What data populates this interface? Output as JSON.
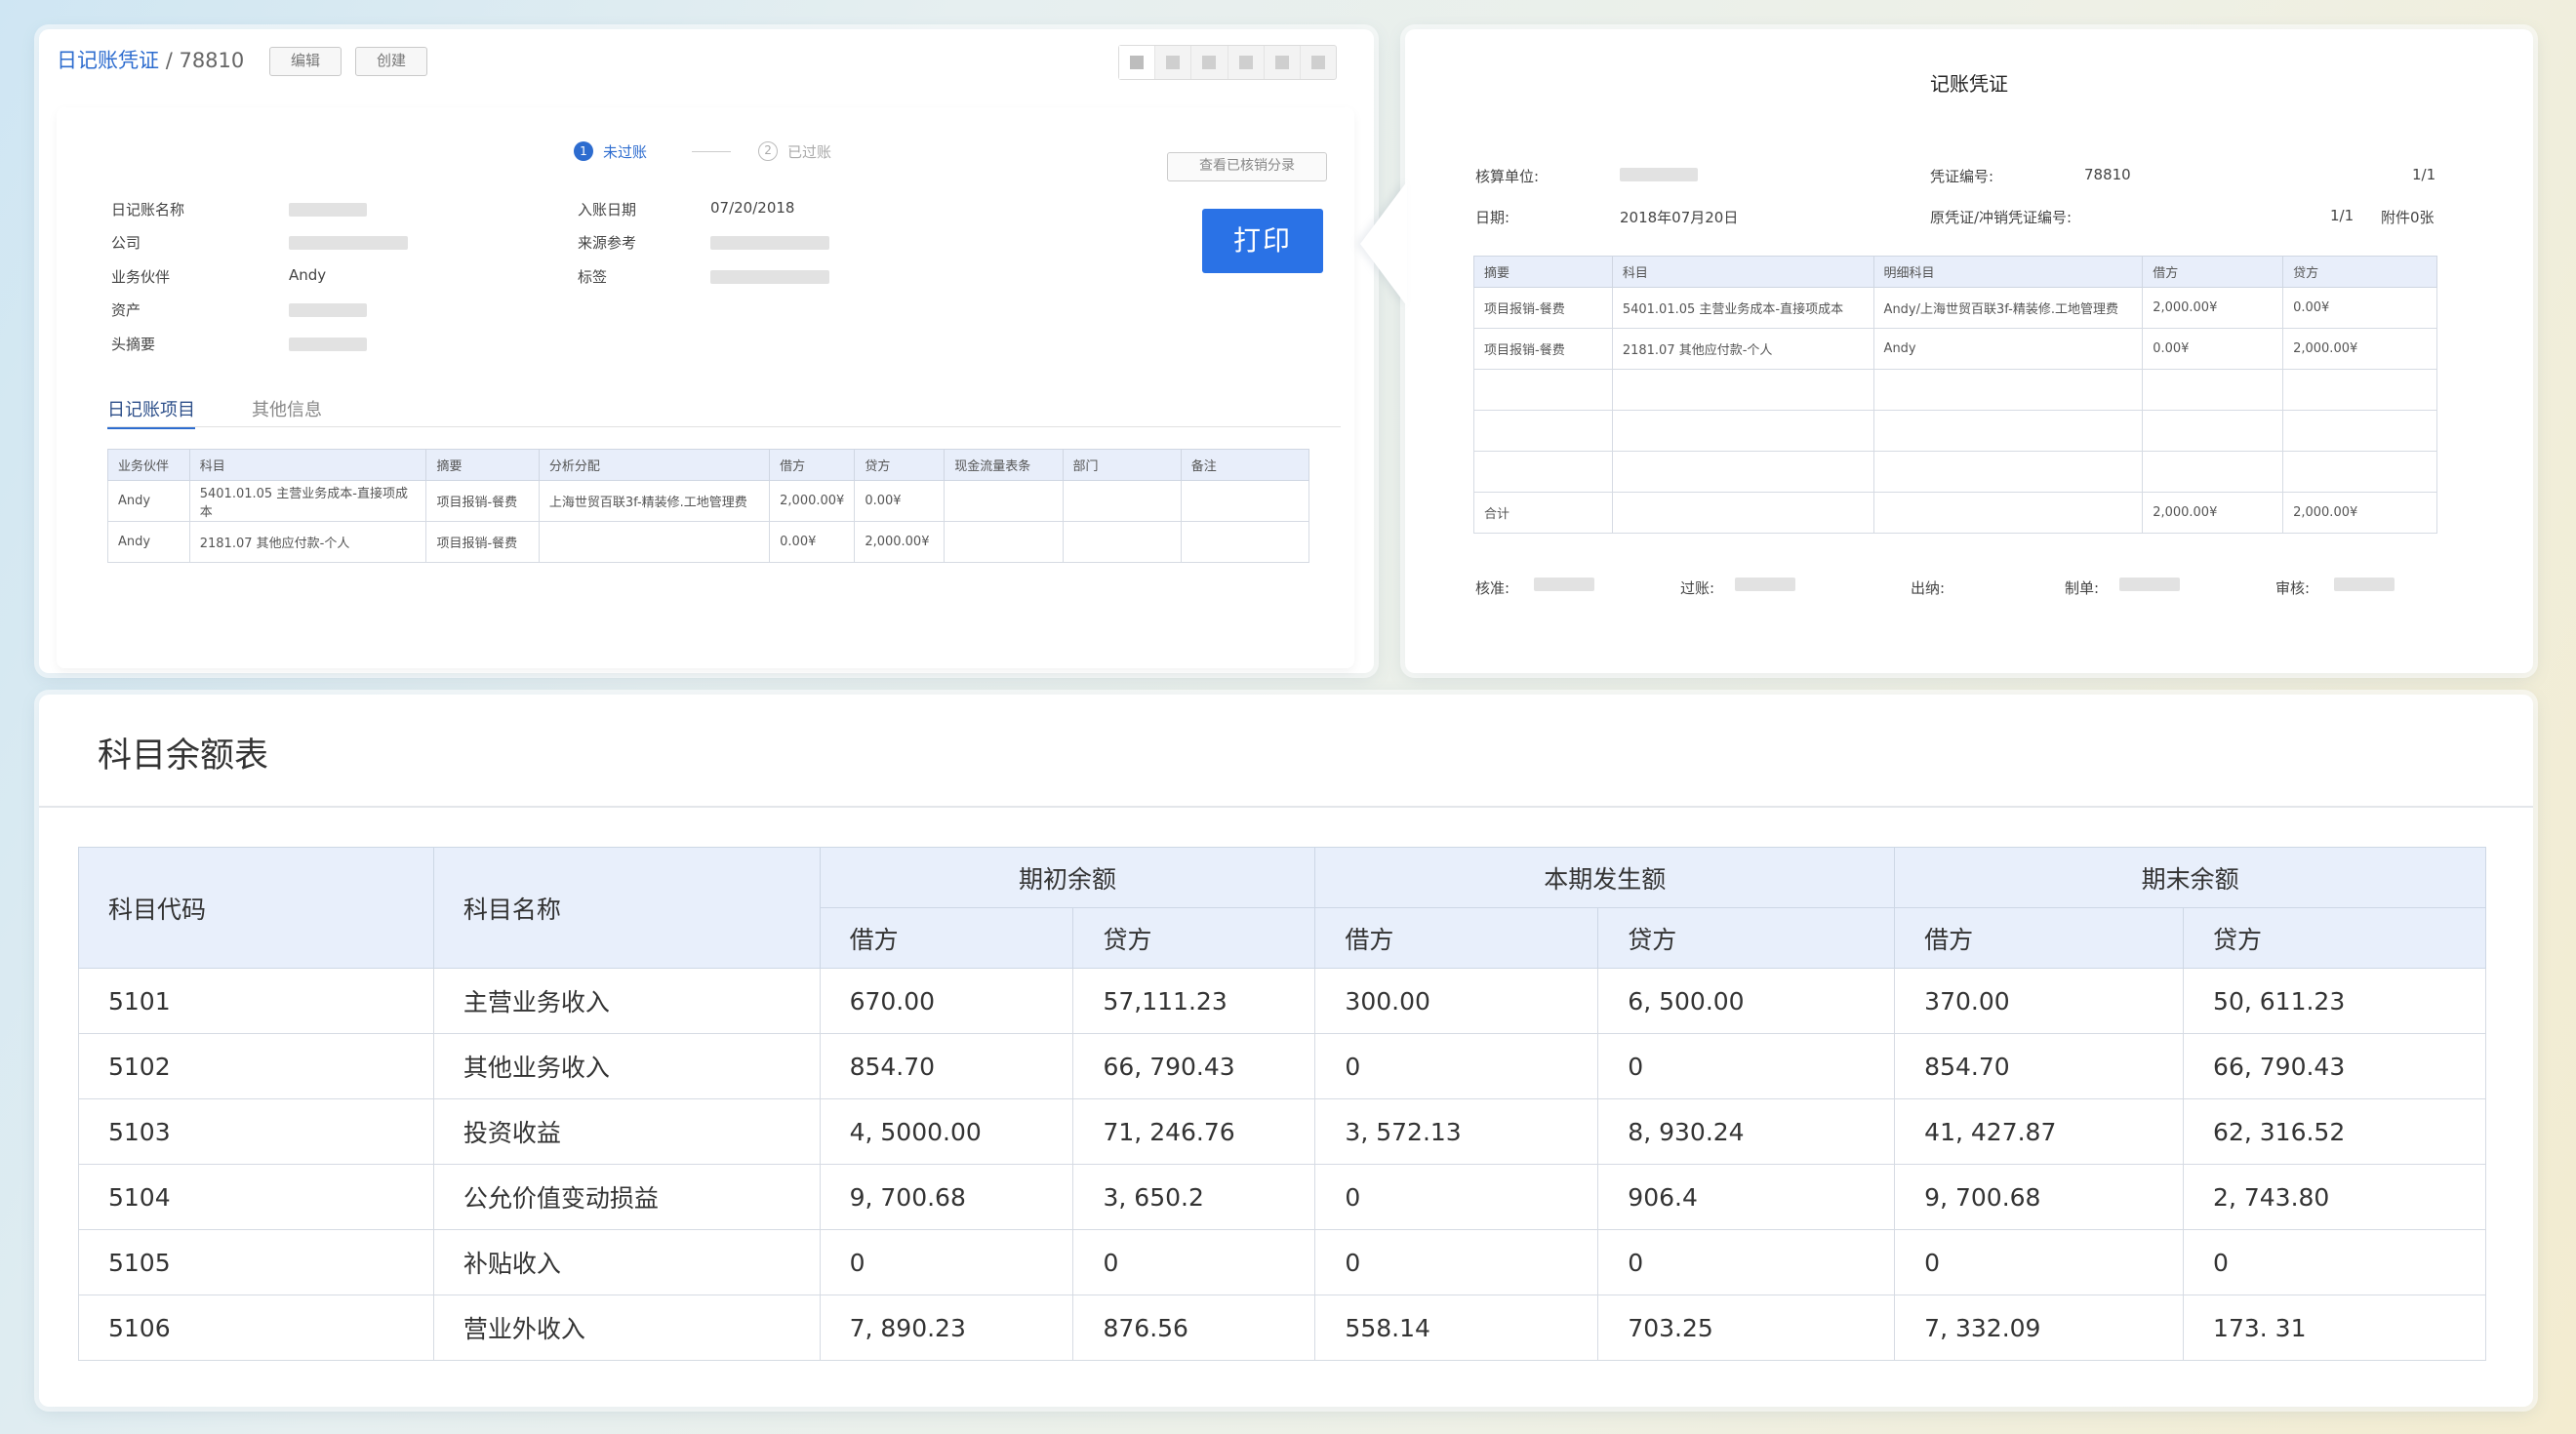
{
  "journal": {
    "breadcrumb_link": "日记账凭证",
    "breadcrumb_sep": "/",
    "voucher_id": "78810",
    "edit_button": "编辑",
    "create_button": "创建",
    "steps": [
      {
        "num": "1",
        "label": "未过账"
      },
      {
        "num": "2",
        "label": "已过账"
      }
    ],
    "view_reconciled_button": "查看已核销分录",
    "print_button": "打印",
    "fields_left": [
      {
        "label": "日记账名称",
        "value": ""
      },
      {
        "label": "公司",
        "value": ""
      },
      {
        "label": "业务伙伴",
        "value": "Andy"
      },
      {
        "label": "资产",
        "value": ""
      },
      {
        "label": "头摘要",
        "value": ""
      }
    ],
    "fields_right": [
      {
        "label": "入账日期",
        "value": "07/20/2018"
      },
      {
        "label": "来源参考",
        "value": ""
      },
      {
        "label": "标签",
        "value": ""
      }
    ],
    "tabs": [
      "日记账项目",
      "其他信息"
    ],
    "table": {
      "headers": [
        "业务伙伴",
        "科目",
        "摘要",
        "分析分配",
        "借方",
        "贷方",
        "现金流量表条",
        "部门",
        "备注"
      ],
      "rows": [
        [
          "Andy",
          "5401.01.05 主营业务成本-直接项成本",
          "项目报销-餐费",
          "上海世贸百联3f-精装修.工地管理费",
          "2,000.00¥",
          "0.00¥",
          "",
          "",
          ""
        ],
        [
          "Andy",
          "2181.07 其他应付款-个人",
          "项目报销-餐费",
          "",
          "0.00¥",
          "2,000.00¥",
          "",
          "",
          ""
        ]
      ]
    }
  },
  "voucher": {
    "title": "记账凭证",
    "unit_label": "核算单位:",
    "voucher_no_label": "凭证编号:",
    "voucher_no": "78810",
    "page": "1/1",
    "date_label": "日期:",
    "date": "2018年07月20日",
    "orig_label": "原凭证/冲销凭证编号:",
    "orig_value": "1/1",
    "attachments": "附件0张",
    "table": {
      "headers": [
        "摘要",
        "科目",
        "明细科目",
        "借方",
        "贷方"
      ],
      "rows": [
        [
          "项目报销-餐费",
          "5401.01.05 主营业务成本-直接项成本",
          "Andy/上海世贸百联3f-精装修.工地管理费",
          "2,000.00¥",
          "0.00¥"
        ],
        [
          "项目报销-餐费",
          "2181.07 其他应付款-个人",
          "Andy",
          "0.00¥",
          "2,000.00¥"
        ],
        [
          "",
          "",
          "",
          "",
          ""
        ],
        [
          "",
          "",
          "",
          "",
          ""
        ],
        [
          "",
          "",
          "",
          "",
          ""
        ]
      ],
      "total": [
        "合计",
        "",
        "",
        "2,000.00¥",
        "2,000.00¥"
      ]
    },
    "signatures": [
      "核准:",
      "过账:",
      "出纳:",
      "制单:",
      "审核:"
    ]
  },
  "balance": {
    "title": "科目余额表",
    "col_code": "科目代码",
    "col_name": "科目名称",
    "groups": [
      "期初余额",
      "本期发生额",
      "期末余额"
    ],
    "sub": [
      "借方",
      "贷方",
      "借方",
      "贷方",
      "借方",
      "贷方"
    ],
    "rows": [
      [
        "5101",
        "主营业务收入",
        "670.00",
        "57,111.23",
        "300.00",
        "6, 500.00",
        "370.00",
        "50, 611.23"
      ],
      [
        "5102",
        "其他业务收入",
        "854.70",
        "66, 790.43",
        "0",
        "0",
        "854.70",
        "66, 790.43"
      ],
      [
        "5103",
        "投资收益",
        "4, 5000.00",
        "71, 246.76",
        "3, 572.13",
        "8, 930.24",
        "41, 427.87",
        "62, 316.52"
      ],
      [
        "5104",
        "公允价值变动损益",
        "9, 700.68",
        "3, 650.2",
        "0",
        "906.4",
        "9, 700.68",
        "2, 743.80"
      ],
      [
        "5105",
        "补贴收入",
        "0",
        "0",
        "0",
        "0",
        "0",
        "0"
      ],
      [
        "5106",
        "营业外收入",
        "7, 890.23",
        "876.56",
        "558.14",
        "703.25",
        "7, 332.09",
        "173. 31"
      ]
    ]
  }
}
